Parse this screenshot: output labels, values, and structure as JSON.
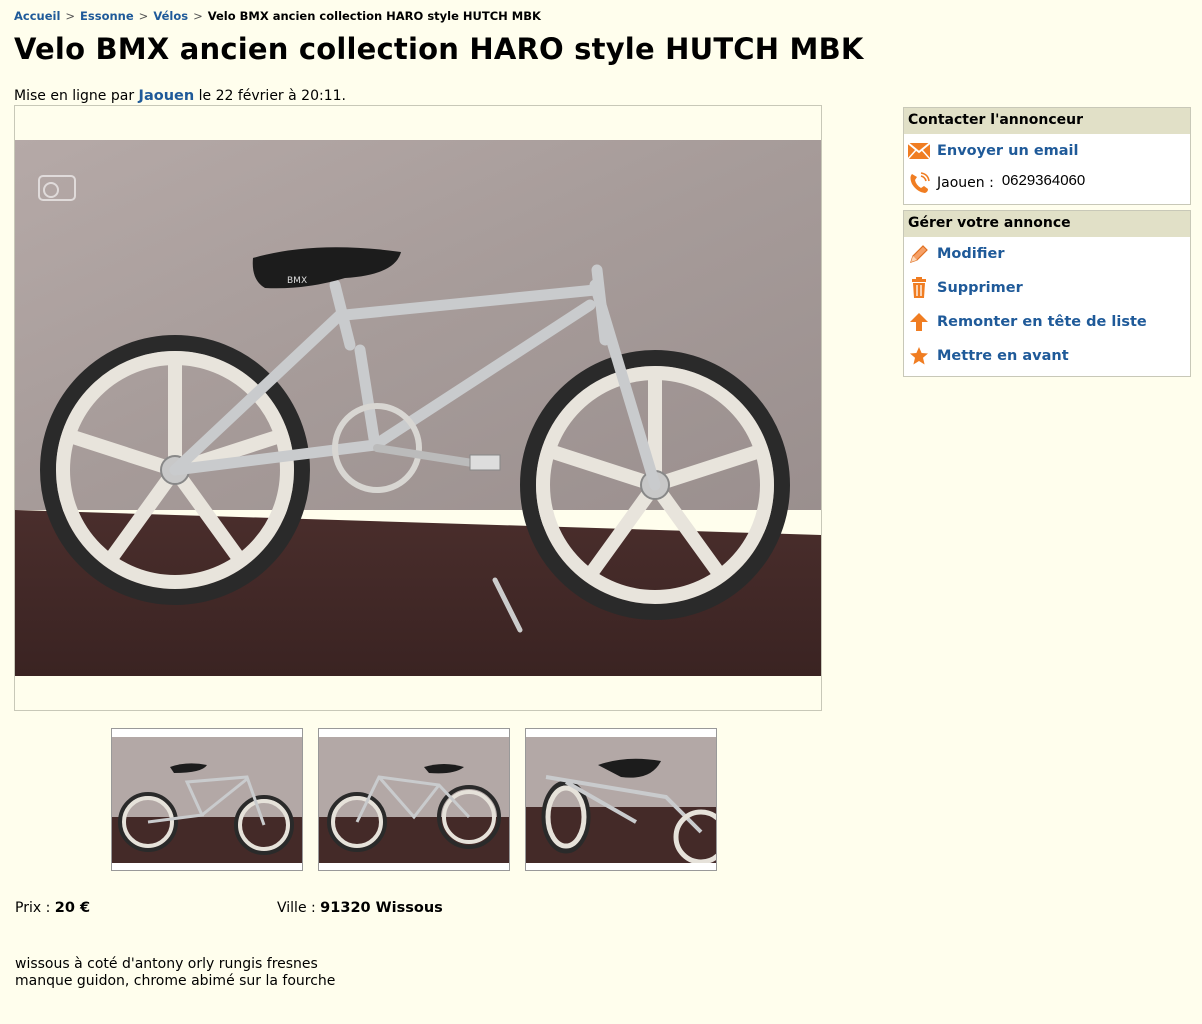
{
  "breadcrumb": {
    "home": "Accueil",
    "region": "Essonne",
    "category": "Vélos",
    "current": "Velo BMX ancien collection HARO style HUTCH MBK",
    "separator": ">"
  },
  "ad": {
    "title": "Velo BMX ancien collection HARO style HUTCH MBK",
    "posted_prefix": "Mise en ligne par",
    "author": "Jaouen",
    "posted_suffix": "le 22 février à 20:11.",
    "price_label": "Prix :",
    "price": "20 €",
    "city_label": "Ville :",
    "city": "91320 Wissous",
    "description_lines": [
      "wissous à coté d'antony orly rungis fresnes",
      "manque guidon, chrome abimé sur la fourche"
    ]
  },
  "contact_box": {
    "header": "Contacter l'annonceur",
    "email_label": "Envoyer un email",
    "email_icon": "envelope-icon",
    "phone_icon": "phone-icon",
    "phone_name": "Jaouen :",
    "phone_number": "0629364060"
  },
  "manage_box": {
    "header": "Gérer votre annonce",
    "items": [
      {
        "label": "Modifier",
        "icon": "pencil-icon"
      },
      {
        "label": "Supprimer",
        "icon": "trash-icon"
      },
      {
        "label": "Remonter en tête de liste",
        "icon": "arrow-up-icon"
      },
      {
        "label": "Mettre en avant",
        "icon": "star-icon"
      }
    ]
  },
  "colors": {
    "background": "#fffeed",
    "link": "#1f5a99",
    "box_header": "#e1e0c7",
    "icon_orange": "#f07d22"
  },
  "photos": {
    "thumbnail_count": 3
  }
}
